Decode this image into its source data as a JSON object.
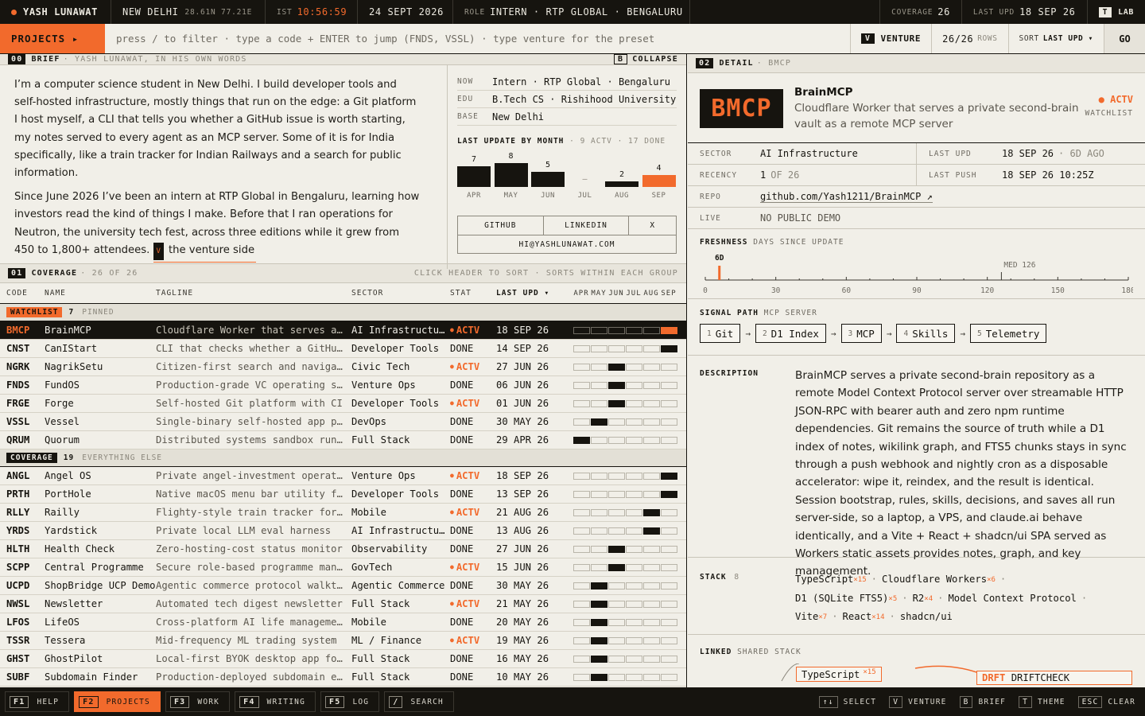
{
  "topbar": {
    "name": "YASH LUNAWAT",
    "city": "NEW DELHI",
    "coords": "28.61N 77.21E",
    "ist_label": "IST",
    "time": "10:56:59",
    "date": "24 SEPT 2026",
    "role_label": "ROLE",
    "role": "INTERN · RTP GLOBAL · BENGALURU",
    "coverage_label": "COVERAGE",
    "coverage": "26",
    "lastupd_label": "LAST UPD",
    "lastupd": "18 SEP 26",
    "lab_key": "T",
    "lab_label": "LAB"
  },
  "cmdbar": {
    "projects_label": "PROJECTS ▸",
    "placeholder": "press / to filter · type a code + ENTER to jump (FNDS, VSSL) · type venture for the preset",
    "venture_key": "V",
    "venture_label": "VENTURE",
    "rows_count": "26/26",
    "rows_label": "ROWS",
    "sort_label": "SORT",
    "sort_value": "LAST UPD ▾",
    "go_label": "GO"
  },
  "brief": {
    "num": "00",
    "title": "BRIEF",
    "subtitle": "· YASH LUNAWAT, IN HIS OWN WORDS",
    "collapse_key": "B",
    "collapse_label": "COLLAPSE",
    "p1": "I’m a computer science student in New Delhi. I build developer tools and self-hosted infrastructure, mostly things that run on the edge: a Git platform I host myself, a CLI that tells you whether a GitHub issue is worth starting, my notes served to every agent as an MCP server. Some of it is for India specifically, like a train tracker for Indian Railways and a search for public information.",
    "p2": "Since June 2026 I’ve been an intern at RTP Global in Bengaluru, learning how investors read the kind of things I make. Before that I ran operations for Neutron, the university tech fest, across three editions while it grew from 450 to 1,800+ attendees.",
    "venture_key": "V",
    "venture_link": "the venture side",
    "now_label": "NOW",
    "now": "Intern · RTP Global · Bengaluru",
    "edu_label": "EDU",
    "edu": "B.Tech CS · Rishihood University",
    "base_label": "BASE",
    "base": "New Delhi",
    "lum_title": "LAST UPDATE BY MONTH",
    "lum_meta": "· 9 ACTV · 17 DONE",
    "months": [
      {
        "label": "APR",
        "value": 7,
        "display": "7"
      },
      {
        "label": "MAY",
        "value": 8,
        "display": "8"
      },
      {
        "label": "JUN",
        "value": 5,
        "display": "5"
      },
      {
        "label": "JUL",
        "value": 0,
        "display": "–"
      },
      {
        "label": "AUG",
        "value": 2,
        "display": "2"
      },
      {
        "label": "SEP",
        "value": 4,
        "display": "4",
        "current": true
      }
    ],
    "github": "GITHUB",
    "linkedin": "LINKEDIN",
    "x": "X",
    "email": "HI@YASHLUNAWAT.COM"
  },
  "coverage": {
    "num": "01",
    "title": "COVERAGE",
    "meta": "· 26 OF 26",
    "hint": "CLICK HEADER TO SORT · SORTS WITHIN EACH GROUP",
    "headers": {
      "code": "CODE",
      "name": "NAME",
      "tagline": "TAGLINE",
      "sector": "SECTOR",
      "stat": "STAT",
      "upd": "LAST UPD ▾"
    },
    "months": [
      "APR",
      "MAY",
      "JUN",
      "JUL",
      "AUG",
      "SEP"
    ],
    "groups": [
      {
        "label": "WATCHLIST",
        "count": "7",
        "desc": "PINNED",
        "color": "#f26a2c",
        "rows": [
          {
            "code": "BMCP",
            "name": "BrainMCP",
            "tag": "Cloudflare Worker that serves a private second-brain vault",
            "sector": "AI Infrastructure",
            "stat": "ACTV",
            "upd": "18 SEP 26",
            "m": 5,
            "sel": true
          },
          {
            "code": "CNST",
            "name": "CanIStart",
            "tag": "CLI that checks whether a GitHub issue is worth starting",
            "sector": "Developer Tools",
            "stat": "DONE",
            "upd": "14 SEP 26",
            "m": 5
          },
          {
            "code": "NGRK",
            "name": "NagrikSetu",
            "tag": "Citizen-first search and navigation for public information",
            "sector": "Civic Tech",
            "stat": "ACTV",
            "upd": "27 JUN 26",
            "m": 2
          },
          {
            "code": "FNDS",
            "name": "FundOS",
            "tag": "Production-grade VC operating system",
            "sector": "Venture Ops",
            "stat": "DONE",
            "upd": "06 JUN 26",
            "m": 2
          },
          {
            "code": "FRGE",
            "name": "Forge",
            "tag": "Self-hosted Git platform with CI",
            "sector": "Developer Tools",
            "stat": "ACTV",
            "upd": "01 JUN 26",
            "m": 2
          },
          {
            "code": "VSSL",
            "name": "Vessel",
            "tag": "Single-binary self-hosted app platform",
            "sector": "DevOps",
            "stat": "DONE",
            "upd": "30 MAY 26",
            "m": 1
          },
          {
            "code": "QRUM",
            "name": "Quorum",
            "tag": "Distributed systems sandbox runtime",
            "sector": "Full Stack",
            "stat": "DONE",
            "upd": "29 APR 26",
            "m": 0
          }
        ]
      },
      {
        "label": "COVERAGE",
        "count": "19",
        "desc": "EVERYTHING ELSE",
        "color": "#16140f",
        "rows": [
          {
            "code": "ANGL",
            "name": "Angel OS",
            "tag": "Private angel-investment operating system",
            "sector": "Venture Ops",
            "stat": "ACTV",
            "upd": "18 SEP 26",
            "m": 5
          },
          {
            "code": "PRTH",
            "name": "PortHole",
            "tag": "Native macOS menu bar utility for ports",
            "sector": "Developer Tools",
            "stat": "DONE",
            "upd": "13 SEP 26",
            "m": 5
          },
          {
            "code": "RLLY",
            "name": "Railly",
            "tag": "Flighty-style train tracker for Indian Railways",
            "sector": "Mobile",
            "stat": "ACTV",
            "upd": "21 AUG 26",
            "m": 4
          },
          {
            "code": "YRDS",
            "name": "Yardstick",
            "tag": "Private local LLM eval harness",
            "sector": "AI Infrastructure",
            "stat": "DONE",
            "upd": "13 AUG 26",
            "m": 4
          },
          {
            "code": "HLTH",
            "name": "Health Check",
            "tag": "Zero-hosting-cost status monitor",
            "sector": "Observability",
            "stat": "DONE",
            "upd": "27 JUN 26",
            "m": 2
          },
          {
            "code": "SCPP",
            "name": "Central Programme",
            "tag": "Secure role-based programme management",
            "sector": "GovTech",
            "stat": "ACTV",
            "upd": "15 JUN 26",
            "m": 2
          },
          {
            "code": "UCPD",
            "name": "ShopBridge UCP Demo",
            "tag": "Agentic commerce protocol walkthrough",
            "sector": "Agentic Commerce",
            "stat": "DONE",
            "upd": "30 MAY 26",
            "m": 1
          },
          {
            "code": "NWSL",
            "name": "Newsletter",
            "tag": "Automated tech digest newsletter",
            "sector": "Full Stack",
            "stat": "ACTV",
            "upd": "21 MAY 26",
            "m": 1
          },
          {
            "code": "LFOS",
            "name": "LifeOS",
            "tag": "Cross-platform AI life management app",
            "sector": "Mobile",
            "stat": "DONE",
            "upd": "20 MAY 26",
            "m": 1
          },
          {
            "code": "TSSR",
            "name": "Tessera",
            "tag": "Mid-frequency ML trading system",
            "sector": "ML / Finance",
            "stat": "ACTV",
            "upd": "19 MAY 26",
            "m": 1
          },
          {
            "code": "GHST",
            "name": "GhostPilot",
            "tag": "Local-first BYOK desktop app for interviews",
            "sector": "Full Stack",
            "stat": "DONE",
            "upd": "16 MAY 26",
            "m": 1
          },
          {
            "code": "SUBF",
            "name": "Subdomain Finder",
            "tag": "Production-deployed subdomain enumeration",
            "sector": "Full Stack",
            "stat": "DONE",
            "upd": "10 MAY 26",
            "m": 1
          }
        ]
      }
    ]
  },
  "detail": {
    "num": "02",
    "title": "DETAIL",
    "code_meta": "· BMCP",
    "logo": "BMCP",
    "name": "BrainMCP",
    "tagline": "Cloudflare Worker that serves a private second-brain vault as a remote MCP server",
    "status": "● ACTV",
    "list": "WATCHLIST",
    "sector_label": "SECTOR",
    "sector": "AI Infrastructure",
    "lastupd_label": "LAST UPD",
    "lastupd": "18 SEP 26",
    "lastupd_ago": "· 6D AGO",
    "recency_label": "RECENCY",
    "recency": "1",
    "recency_of": "OF 26",
    "lastpush_label": "LAST PUSH",
    "lastpush": "18 SEP 26 10:25Z",
    "repo_label": "REPO",
    "repo": "github.com/Yash1211/BrainMCP ↗",
    "live_label": "LIVE",
    "live": "NO PUBLIC DEMO",
    "fresh_title": "FRESHNESS",
    "fresh_sub": "DAYS SINCE UPDATE",
    "fresh_value": 6,
    "fresh_value_label": "6D",
    "fresh_median": 126,
    "fresh_median_label": "MED 126",
    "fresh_ticks": [
      "0",
      "30",
      "60",
      "90",
      "120",
      "150",
      "180"
    ],
    "fresh_max": 180,
    "signal_title": "SIGNAL PATH",
    "signal_sub": "MCP SERVER",
    "steps": [
      {
        "n": "1",
        "label": "Git"
      },
      {
        "n": "2",
        "label": "D1 Index"
      },
      {
        "n": "3",
        "label": "MCP"
      },
      {
        "n": "4",
        "label": "Skills"
      },
      {
        "n": "5",
        "label": "Telemetry"
      }
    ],
    "desc_label": "DESCRIPTION",
    "description": "BrainMCP serves a private second-brain repository as a remote Model Context Protocol server over streamable HTTP JSON-RPC with bearer auth and zero npm runtime dependencies. Git remains the source of truth while a D1 index of notes, wikilink graph, and FTS5 chunks stays in sync through a push webhook and nightly cron as a disposable accelerator: wipe it, reindex, and the result is identical. Session bootstrap, rules, skills, decisions, and saves all run server-side, so a laptop, a VPS, and claude.ai behave identically, and a Vite + React + shadcn/ui SPA served as Workers static assets provides notes, graph, and key management.",
    "stack_label": "STACK",
    "stack_count": "8",
    "stack": [
      {
        "name": "TypeScript",
        "count": "×15"
      },
      {
        "name": "Cloudflare Workers",
        "count": "×6"
      },
      {
        "name": "D1 (SQLite FTS5)",
        "count": "×5"
      },
      {
        "name": "R2",
        "count": "×4"
      },
      {
        "name": "Model Context Protocol",
        "count": ""
      },
      {
        "name": "Vite",
        "count": "×7"
      },
      {
        "name": "React",
        "count": "×14"
      },
      {
        "name": "shadcn/ui",
        "count": ""
      }
    ],
    "linked_title": "LINKED",
    "linked_sub": "SHARED STACK",
    "linked_box1": "TypeScript",
    "linked_box1_count": "×15",
    "linked_box2_code": "DRFT",
    "linked_box2_name": "DRIFTCHECK"
  },
  "footer": {
    "keys": [
      {
        "key": "F1",
        "label": "HELP",
        "active": false
      },
      {
        "key": "F2",
        "label": "PROJECTS",
        "active": true
      },
      {
        "key": "F3",
        "label": "WORK",
        "active": false
      },
      {
        "key": "F4",
        "label": "WRITING",
        "active": false
      },
      {
        "key": "F5",
        "label": "LOG",
        "active": false
      },
      {
        "key": "/",
        "label": "SEARCH",
        "active": false
      }
    ],
    "right": [
      {
        "key": "↑↓",
        "label": "SELECT"
      },
      {
        "key": "V",
        "label": "VENTURE"
      },
      {
        "key": "B",
        "label": "BRIEF"
      },
      {
        "key": "T",
        "label": "THEME"
      },
      {
        "key": "ESC",
        "label": "CLEAR"
      }
    ]
  },
  "colors": {
    "accent": "#f26a2c",
    "ink": "#16140f",
    "paper": "#f1efe8"
  }
}
